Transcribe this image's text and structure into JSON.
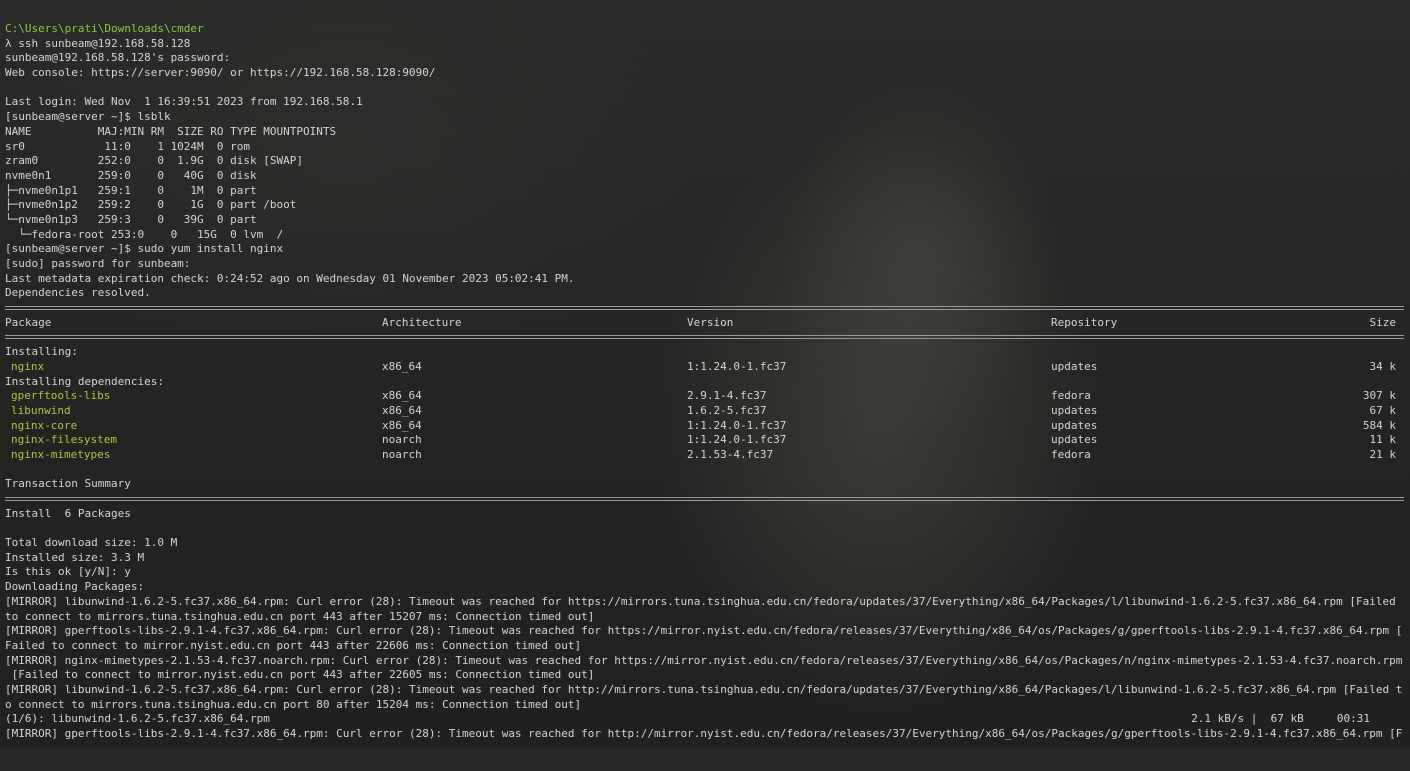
{
  "prompt_path": "C:\\Users\\prati\\Downloads\\cmder",
  "session": [
    "λ ssh sunbeam@192.168.58.128",
    "sunbeam@192.168.58.128's password:",
    "Web console: https://server:9090/ or https://192.168.58.128:9090/",
    "",
    "Last login: Wed Nov  1 16:39:51 2023 from 192.168.58.1",
    "[sunbeam@server ~]$ lsblk"
  ],
  "lsblk": {
    "header": "NAME          MAJ:MIN RM  SIZE RO TYPE MOUNTPOINTS",
    "rows": [
      "sr0            11:0    1 1024M  0 rom",
      "zram0         252:0    0  1.9G  0 disk [SWAP]",
      "nvme0n1       259:0    0   40G  0 disk",
      "├─nvme0n1p1   259:1    0    1M  0 part",
      "├─nvme0n1p2   259:2    0    1G  0 part /boot",
      "└─nvme0n1p3   259:3    0   39G  0 part",
      "  └─fedora-root 253:0    0   15G  0 lvm  /"
    ]
  },
  "yum_intro": [
    "[sunbeam@server ~]$ sudo yum install nginx",
    "[sudo] password for sunbeam:",
    "Last metadata expiration check: 0:24:52 ago on Wednesday 01 November 2023 05:02:41 PM.",
    "Dependencies resolved."
  ],
  "table": {
    "headers": {
      "package": "Package",
      "arch": "Architecture",
      "version": "Version",
      "repo": "Repository",
      "size": "Size"
    },
    "installing_label": "Installing:",
    "installing": [
      {
        "package": "nginx",
        "arch": "x86_64",
        "version": "1:1.24.0-1.fc37",
        "repo": "updates",
        "size": "34 k"
      }
    ],
    "deps_label": "Installing dependencies:",
    "deps": [
      {
        "package": "gperftools-libs",
        "arch": "x86_64",
        "version": "2.9.1-4.fc37",
        "repo": "fedora",
        "size": "307 k"
      },
      {
        "package": "libunwind",
        "arch": "x86_64",
        "version": "1.6.2-5.fc37",
        "repo": "updates",
        "size": "67 k"
      },
      {
        "package": "nginx-core",
        "arch": "x86_64",
        "version": "1:1.24.0-1.fc37",
        "repo": "updates",
        "size": "584 k"
      },
      {
        "package": "nginx-filesystem",
        "arch": "noarch",
        "version": "1:1.24.0-1.fc37",
        "repo": "updates",
        "size": "11 k"
      },
      {
        "package": "nginx-mimetypes",
        "arch": "noarch",
        "version": "2.1.53-4.fc37",
        "repo": "fedora",
        "size": "21 k"
      }
    ]
  },
  "summary": {
    "title": "Transaction Summary",
    "install_line": "Install  6 Packages",
    "lines": [
      "Total download size: 1.0 M",
      "Installed size: 3.3 M",
      "Is this ok [y/N]: y",
      "Downloading Packages:",
      "[MIRROR] libunwind-1.6.2-5.fc37.x86_64.rpm: Curl error (28): Timeout was reached for https://mirrors.tuna.tsinghua.edu.cn/fedora/updates/37/Everything/x86_64/Packages/l/libunwind-1.6.2-5.fc37.x86_64.rpm [Failed",
      "to connect to mirrors.tuna.tsinghua.edu.cn port 443 after 15207 ms: Connection timed out]",
      "[MIRROR] gperftools-libs-2.9.1-4.fc37.x86_64.rpm: Curl error (28): Timeout was reached for https://mirror.nyist.edu.cn/fedora/releases/37/Everything/x86_64/os/Packages/g/gperftools-libs-2.9.1-4.fc37.x86_64.rpm [",
      "Failed to connect to mirror.nyist.edu.cn port 443 after 22606 ms: Connection timed out]",
      "[MIRROR] nginx-mimetypes-2.1.53-4.fc37.noarch.rpm: Curl error (28): Timeout was reached for https://mirror.nyist.edu.cn/fedora/releases/37/Everything/x86_64/os/Packages/n/nginx-mimetypes-2.1.53-4.fc37.noarch.rpm",
      " [Failed to connect to mirror.nyist.edu.cn port 443 after 22605 ms: Connection timed out]",
      "[MIRROR] libunwind-1.6.2-5.fc37.x86_64.rpm: Curl error (28): Timeout was reached for http://mirrors.tuna.tsinghua.edu.cn/fedora/updates/37/Everything/x86_64/Packages/l/libunwind-1.6.2-5.fc37.x86_64.rpm [Failed t",
      "o connect to mirrors.tuna.tsinghua.edu.cn port 80 after 15204 ms: Connection timed out]"
    ],
    "progress": {
      "left": "(1/6): libunwind-1.6.2-5.fc37.x86_64.rpm",
      "right": "2.1 kB/s |  67 kB     00:31"
    },
    "last_line": "[MIRROR] gperftools-libs-2.9.1-4.fc37.x86_64.rpm: Curl error (28): Timeout was reached for http://mirror.nyist.edu.cn/fedora/releases/37/Everything/x86_64/os/Packages/g/gperftools-libs-2.9.1-4.fc37.x86_64.rpm [F"
  }
}
